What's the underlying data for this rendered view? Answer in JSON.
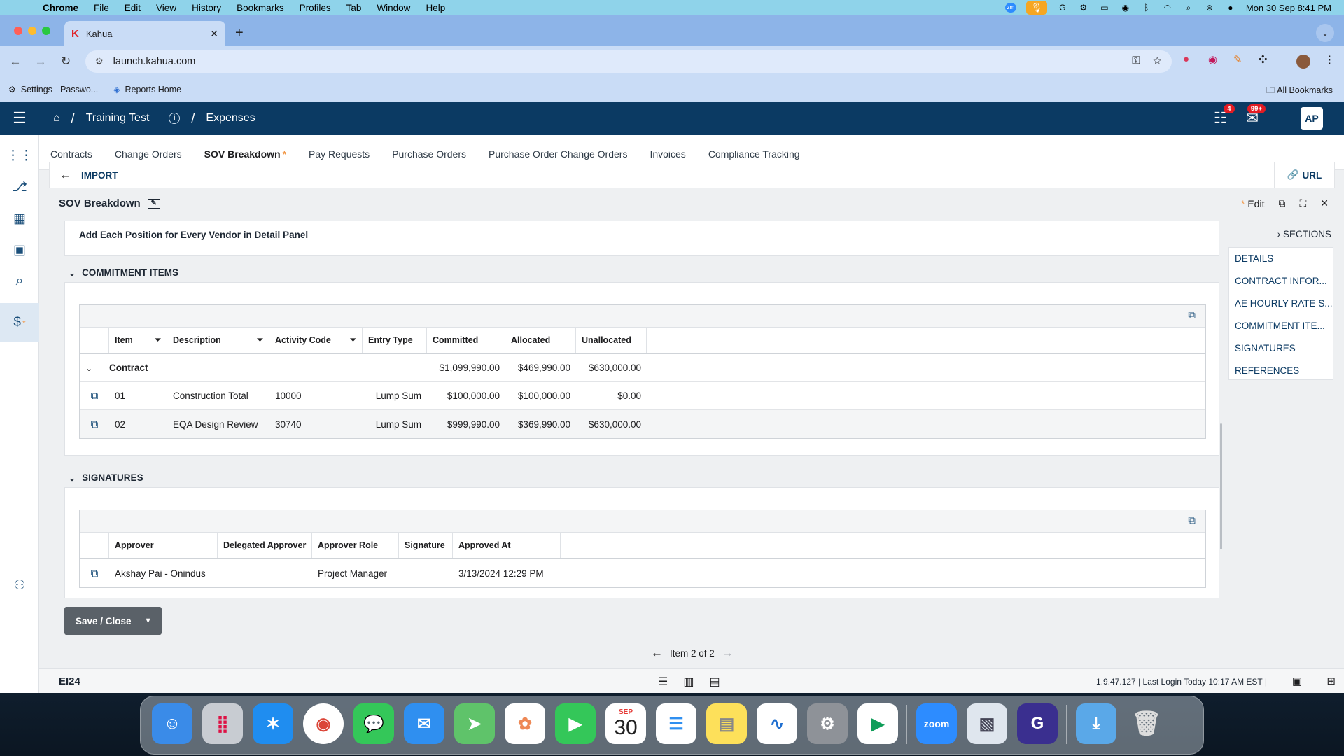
{
  "menubar": {
    "app": "Chrome",
    "items": [
      "File",
      "Edit",
      "View",
      "History",
      "Bookmarks",
      "Profiles",
      "Tab",
      "Window",
      "Help"
    ],
    "datetime": "Mon 30 Sep  8:41 PM"
  },
  "browser": {
    "tab_title": "Kahua",
    "url": "launch.kahua.com",
    "bookmarks": [
      "Settings - Passwo...",
      "Reports Home"
    ],
    "all_bookmarks": "All Bookmarks"
  },
  "header": {
    "project": "Training Test",
    "module": "Expenses",
    "tasks_badge": "4",
    "messages_badge": "99+",
    "avatar": "AP"
  },
  "tabs": [
    {
      "label": "Contracts"
    },
    {
      "label": "Change Orders"
    },
    {
      "label": "SOV Breakdown",
      "active": true,
      "star": "*"
    },
    {
      "label": "Pay Requests"
    },
    {
      "label": "Purchase Orders"
    },
    {
      "label": "Purchase Order Change Orders"
    },
    {
      "label": "Invoices"
    },
    {
      "label": "Compliance Tracking"
    }
  ],
  "importbar": {
    "label": "IMPORT",
    "url_label": "URL"
  },
  "panel": {
    "title": "SOV Breakdown",
    "edit_star": "*",
    "edit_label": "Edit"
  },
  "note": "Add Each Position for Every Vendor in Detail Panel",
  "commitment": {
    "heading": "COMMITMENT ITEMS",
    "columns": [
      "Item",
      "Description",
      "Activity Code",
      "Entry Type",
      "Committed",
      "Allocated",
      "Unallocated"
    ],
    "group": {
      "label": "Contract",
      "committed": "$1,099,990.00",
      "allocated": "$469,990.00",
      "unallocated": "$630,000.00"
    },
    "rows": [
      {
        "item": "01",
        "description": "Construction Total",
        "activity_code": "10000",
        "entry_type": "Lump Sum",
        "committed": "$100,000.00",
        "allocated": "$100,000.00",
        "unallocated": "$0.00"
      },
      {
        "item": "02",
        "description": "EQA Design Review",
        "activity_code": "30740",
        "entry_type": "Lump Sum",
        "committed": "$999,990.00",
        "allocated": "$369,990.00",
        "unallocated": "$630,000.00"
      }
    ]
  },
  "signatures": {
    "heading": "SIGNATURES",
    "columns": [
      "Approver",
      "Delegated Approver",
      "Approver Role",
      "Signature",
      "Approved At"
    ],
    "rows": [
      {
        "approver": "Akshay Pai - Onindus",
        "delegated": "",
        "role": "Project Manager",
        "signature": "",
        "approved_at": "3/13/2024 12:29 PM"
      }
    ]
  },
  "sections": {
    "toggle": "SECTIONS",
    "items": [
      "DETAILS",
      "CONTRACT INFOR...",
      "AE HOURLY RATE S...",
      "COMMITMENT ITE...",
      "SIGNATURES",
      "REFERENCES"
    ]
  },
  "save_label": "Save / Close",
  "pager": "Item 2 of 2",
  "footer": {
    "logo": "EI24",
    "version": "1.9.47.127",
    "last_login": "Last Login Today 10:17 AM EST"
  },
  "dock": {
    "calendar_month": "SEP",
    "calendar_day": "30",
    "zoom_label": "zoom"
  }
}
